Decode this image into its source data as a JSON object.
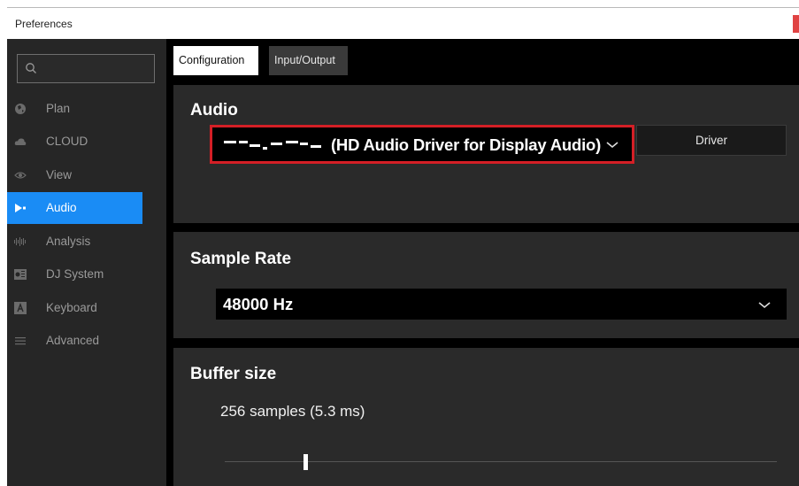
{
  "window": {
    "title": "Preferences"
  },
  "sidebar": {
    "search_placeholder": "",
    "items": [
      {
        "label": "Plan",
        "icon": "globe-icon"
      },
      {
        "label": "CLOUD",
        "icon": "cloud-icon"
      },
      {
        "label": "View",
        "icon": "eye-icon"
      },
      {
        "label": "Audio",
        "icon": "speaker-icon",
        "active": true
      },
      {
        "label": "Analysis",
        "icon": "waveform-icon"
      },
      {
        "label": "DJ System",
        "icon": "dj-system-icon"
      },
      {
        "label": "Keyboard",
        "icon": "keyboard-key-icon"
      },
      {
        "label": "Advanced",
        "icon": "menu-lines-icon"
      }
    ]
  },
  "tabs": [
    {
      "label": "Configuration",
      "active": true
    },
    {
      "label": "Input/Output",
      "active": false
    }
  ],
  "audio": {
    "heading": "Audio",
    "device_name_suffix": "(HD Audio Driver for Display Audio)",
    "driver_button": "Driver"
  },
  "sample_rate": {
    "heading": "Sample Rate",
    "value": "48000 Hz"
  },
  "buffer": {
    "heading": "Buffer size",
    "value": "256 samples (5.3 ms)",
    "slider_position": 0.15
  },
  "colors": {
    "accent": "#1a8cf5",
    "highlight_border": "#d41f26",
    "panel": "#2a2a2a",
    "sidebar": "#262626"
  }
}
